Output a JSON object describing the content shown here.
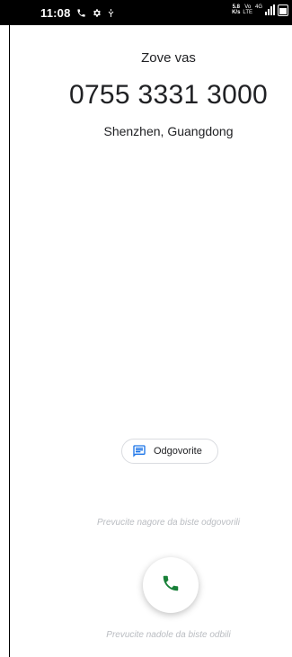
{
  "status_bar": {
    "time": "11:08",
    "network_speed": "5.8\nK/s",
    "volte_label": "Vo\nLTE",
    "network_type": "4G"
  },
  "incoming_call": {
    "label": "Zove vas",
    "number": "0755 3331 3000",
    "location": "Shenzhen, Guangdong"
  },
  "actions": {
    "reply_label": "Odgovorite",
    "swipe_up_hint": "Prevucite nagore da biste odgovorili",
    "swipe_down_hint": "Prevucite nadole da biste odbili"
  },
  "colors": {
    "accent_blue": "#1a73e8",
    "answer_green": "#188038",
    "hint_gray": "#b9bcc1"
  },
  "icons": {
    "status_call": "phone-icon",
    "status_settings": "gear-icon",
    "status_sync": "sync-icon",
    "reply": "message-icon",
    "answer": "phone-icon"
  }
}
